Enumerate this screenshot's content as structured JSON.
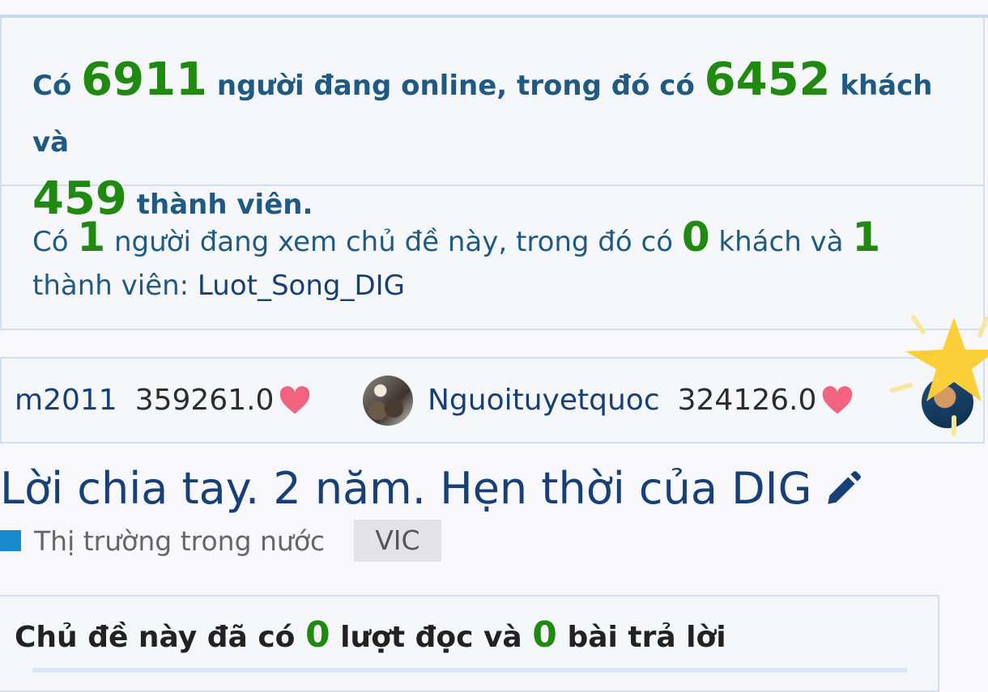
{
  "online_stats": {
    "prefix": "Có",
    "total": "6911",
    "mid_text": "người đang online, trong đó có",
    "guests": "6452",
    "guests_text": "khách và",
    "members": "459",
    "members_text": "thành viên."
  },
  "viewing_stats": {
    "prefix": "Có",
    "total": "1",
    "mid_text": "người đang xem chủ đề này, trong đó có",
    "guests": "0",
    "guests_text": "khách và",
    "members": "1",
    "members_text": "thành viên:",
    "member_name": "Luot_Song_DIG"
  },
  "leaderboard": [
    {
      "name": "m2011",
      "score": "359261.0"
    },
    {
      "name": "Nguoituyetquoc",
      "score": "324126.0"
    }
  ],
  "thread": {
    "title": "Lời chia tay. 2 năm. Hẹn thời của DIG",
    "category": "Thị trường trong nước",
    "tag": "VIC",
    "info_prefix": "Chủ đề này đã có",
    "views": "0",
    "views_text": "lượt đọc và",
    "replies": "0",
    "replies_text": "bài trả lời"
  },
  "icons": {
    "heart": "heart-icon",
    "edit": "pencil-icon",
    "star": "star-icon"
  },
  "colors": {
    "number_green": "#1f8a0f",
    "text_blue": "#1f5a85",
    "title_blue": "#173f78",
    "heart_pink": "#f1637e",
    "category_blue": "#1a8ad1"
  }
}
